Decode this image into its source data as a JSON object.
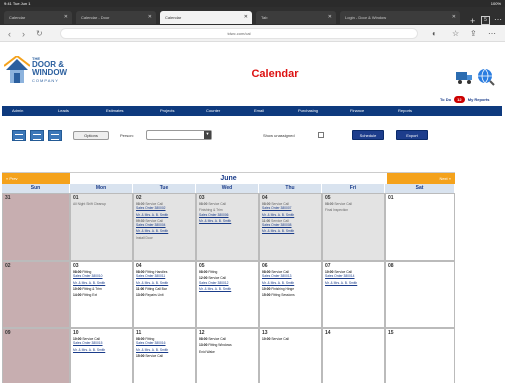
{
  "os": {
    "time": "9:41 Tue Jun 1",
    "status_right": "100%"
  },
  "tabs": [
    {
      "label": "Calendar"
    },
    {
      "label": "Calendar - Door"
    },
    {
      "label": "Calendar"
    },
    {
      "label": "Tab"
    },
    {
      "label": "Login - Door & Window"
    }
  ],
  "browser": {
    "url": "tdwc.com/cal",
    "tab_count": "5"
  },
  "brand": {
    "line1": "THE",
    "line2a": "DOOR &",
    "line2b": "WINDOW",
    "line3": "COMPANY"
  },
  "page_title": "Calendar",
  "user_links": {
    "to_do": "To Do",
    "count": "12",
    "reports": "My Reports"
  },
  "nav": [
    "Admin",
    "Leads",
    "Estimates",
    "Projects",
    "Counter",
    "Email",
    "Purchasing",
    "Finance",
    "Reports"
  ],
  "toolbar": {
    "options_btn": "Options",
    "person_label": "Person:",
    "person_value": "",
    "show_unassigned": "Show unassigned",
    "schedule_btn": "Schedule",
    "export_btn": "Export"
  },
  "calendar": {
    "month": "June",
    "prev": "« Prev",
    "next": "Next »",
    "days": [
      "Sun",
      "Mon",
      "Tue",
      "Wed",
      "Thu",
      "Fri",
      "Sat"
    ],
    "weeks": [
      [
        {
          "num": "31",
          "style": "sun",
          "events": []
        },
        {
          "num": "01",
          "style": "grey",
          "events": [
            {
              "time": "",
              "text": "All Night Shift Cleanup",
              "link": "",
              "muted": true
            }
          ]
        },
        {
          "num": "02",
          "style": "grey",
          "events": [
            {
              "time": "08:00",
              "text": "Service Call",
              "link": "Sales Order 380002",
              "muted": true
            },
            {
              "time": "",
              "text": "",
              "link": "Mr. & Mrs. A. B. Smith",
              "muted": true
            },
            {
              "time": "09:30",
              "text": "Service Call",
              "link": "Sales Order 380004",
              "muted": true
            },
            {
              "time": "",
              "text": "",
              "link": "Mr. & Mrs. A. B. Smith",
              "muted": true
            },
            {
              "time": "",
              "text": "Install Door",
              "link": "",
              "muted": true
            }
          ]
        },
        {
          "num": "03",
          "style": "grey",
          "events": [
            {
              "time": "08:00",
              "text": "Service Call",
              "link": "",
              "muted": true
            },
            {
              "time": "",
              "text": "Finishing & Trim",
              "link": "Sales Order 380006",
              "muted": true
            },
            {
              "time": "",
              "text": "",
              "link": "Mr. & Mrs. A. B. Smith",
              "muted": true
            }
          ]
        },
        {
          "num": "04",
          "style": "grey",
          "events": [
            {
              "time": "08:00",
              "text": "Service Call",
              "link": "Sales Order 380007",
              "muted": true
            },
            {
              "time": "",
              "text": "",
              "link": "Mr. & Mrs. A. B. Smith",
              "muted": true
            },
            {
              "time": "11:00",
              "text": "Service Call",
              "link": "Sales Order 380008",
              "muted": true
            },
            {
              "time": "",
              "text": "",
              "link": "Mr. & Mrs. A. B. Smith",
              "muted": true
            }
          ]
        },
        {
          "num": "05",
          "style": "grey",
          "events": [
            {
              "time": "08:00",
              "text": "Service Call",
              "link": "",
              "muted": true
            },
            {
              "time": "",
              "text": "Final Inspection",
              "link": "",
              "muted": true
            }
          ]
        },
        {
          "num": "01",
          "style": "sat",
          "events": []
        }
      ],
      [
        {
          "num": "02",
          "style": "sun",
          "events": []
        },
        {
          "num": "03",
          "style": "",
          "events": [
            {
              "time": "08:00",
              "text": "Fitting",
              "link": "Sales Order 380010",
              "muted": false
            },
            {
              "time": "",
              "text": "",
              "link": "Mr. & Mrs. A. B. Smith",
              "muted": false
            },
            {
              "time": "10:00",
              "text": "Fitting & Trim",
              "link": "",
              "muted": false
            },
            {
              "time": "14:00",
              "text": "Fitting Ext",
              "link": "",
              "muted": false
            }
          ]
        },
        {
          "num": "04",
          "style": "",
          "events": [
            {
              "time": "08:00",
              "text": "Fitting Handles",
              "link": "Sales Order 380011",
              "muted": false
            },
            {
              "time": "",
              "text": "",
              "link": "Mr. & Mrs. A. B. Smith",
              "muted": false
            },
            {
              "time": "11:00",
              "text": "Fitting Call Bar",
              "link": "",
              "muted": false
            },
            {
              "time": "13:00",
              "text": "Repairs Unit",
              "link": "",
              "muted": false
            }
          ]
        },
        {
          "num": "05",
          "style": "",
          "events": [
            {
              "time": "08:00",
              "text": "Fitting",
              "link": "",
              "muted": false
            },
            {
              "time": "12:00",
              "text": "Service Call",
              "link": "Sales Order 380012",
              "muted": false
            },
            {
              "time": "",
              "text": "",
              "link": "Mr. & Mrs. A. B. Smith",
              "muted": false
            }
          ]
        },
        {
          "num": "06",
          "style": "",
          "events": [
            {
              "time": "08:00",
              "text": "Service Call",
              "link": "Sales Order 380013",
              "muted": false
            },
            {
              "time": "",
              "text": "",
              "link": "Mr. & Mrs. A. B. Smith",
              "muted": false
            },
            {
              "time": "10:00",
              "text": "Finishing Hinge",
              "link": "",
              "muted": false
            },
            {
              "time": "15:00",
              "text": "Fitting Sessions",
              "link": "",
              "muted": false
            }
          ]
        },
        {
          "num": "07",
          "style": "",
          "events": [
            {
              "time": "10:00",
              "text": "Service Call",
              "link": "Sales Order 380014",
              "muted": false
            },
            {
              "time": "",
              "text": "",
              "link": "Mr. & Mrs. A. B. Smith",
              "muted": false
            }
          ]
        },
        {
          "num": "08",
          "style": "sat",
          "events": []
        }
      ],
      [
        {
          "num": "09",
          "style": "sun",
          "events": []
        },
        {
          "num": "10",
          "style": "",
          "events": [
            {
              "time": "10:00",
              "text": "Service Call",
              "link": "Sales Order 380015",
              "muted": false
            },
            {
              "time": "",
              "text": "",
              "link": "Mr. & Mrs. A. B. Smith",
              "muted": false
            }
          ]
        },
        {
          "num": "11",
          "style": "",
          "events": [
            {
              "time": "08:00",
              "text": "Fitting",
              "link": "Sales Order 380016",
              "muted": false
            },
            {
              "time": "",
              "text": "",
              "link": "Mr. & Mrs. A. B. Smith",
              "muted": false
            },
            {
              "time": "15:00",
              "text": "Service Call",
              "link": "",
              "muted": false
            }
          ]
        },
        {
          "num": "12",
          "style": "",
          "events": [
            {
              "time": "08:00",
              "text": "Service Call",
              "link": "",
              "muted": false
            },
            {
              "time": "13:00",
              "text": "Fitting Windows",
              "link": "",
              "muted": false
            },
            {
              "time": "",
              "text": "Enid Wake",
              "link": "",
              "muted": false
            }
          ]
        },
        {
          "num": "13",
          "style": "",
          "events": [
            {
              "time": "10:00",
              "text": "Service Call",
              "link": "",
              "muted": false
            }
          ]
        },
        {
          "num": "14",
          "style": "",
          "events": []
        },
        {
          "num": "15",
          "style": "sat",
          "events": []
        }
      ]
    ]
  }
}
